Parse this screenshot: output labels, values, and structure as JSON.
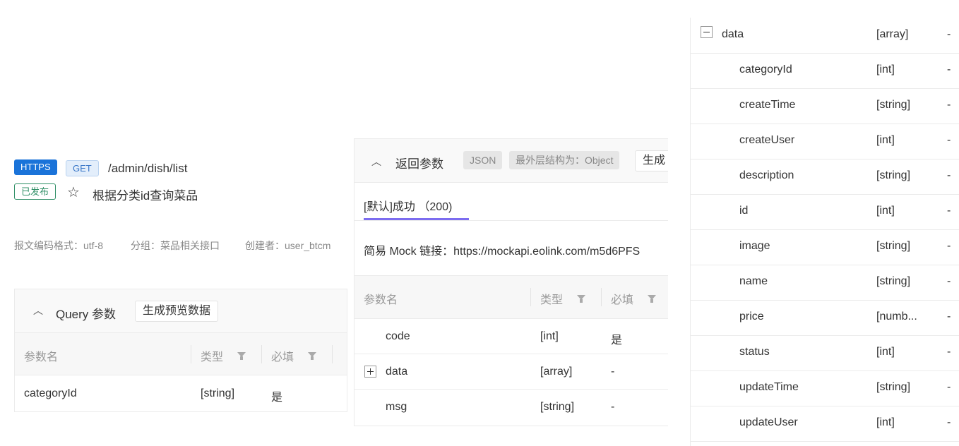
{
  "api": {
    "protocol": "HTTPS",
    "method": "GET",
    "path": "/admin/dish/list",
    "status": "已发布",
    "name": "根据分类id查询菜品",
    "star_icon": "star-icon"
  },
  "meta": {
    "encoding": "报文编码格式：utf-8",
    "group": "分组：菜品相关接口",
    "creator": "创建者：user_btcm"
  },
  "query": {
    "title": "Query 参数",
    "generate_button": "生成预览数据",
    "columns": [
      "参数名",
      "类型",
      "必填"
    ],
    "rows": [
      {
        "name": "categoryId",
        "type": "[string]",
        "required": "是"
      }
    ]
  },
  "response": {
    "title": "返回参数",
    "format_pill": "JSON",
    "outer_pill": "最外层结构为：Object",
    "generate_button": "生成",
    "tab": "[默认]成功 （200)",
    "mock_link": "简易 Mock 链接：https://mockapi.eolink.com/m5d6PFS",
    "columns": [
      "参数名",
      "类型",
      "必填"
    ],
    "rows": [
      {
        "name": "code",
        "type": "[int]",
        "required": "是"
      },
      {
        "name": "data",
        "type": "[array]",
        "required": "-"
      },
      {
        "name": "msg",
        "type": "[string]",
        "required": "-"
      }
    ]
  },
  "data_detail": {
    "rows": [
      {
        "name": "data",
        "type": "[array]",
        "required": "-"
      },
      {
        "name": "categoryId",
        "type": "[int]",
        "required": "-"
      },
      {
        "name": "createTime",
        "type": "[string]",
        "required": "-"
      },
      {
        "name": "createUser",
        "type": "[int]",
        "required": "-"
      },
      {
        "name": "description",
        "type": "[string]",
        "required": "-"
      },
      {
        "name": "id",
        "type": "[int]",
        "required": "-"
      },
      {
        "name": "image",
        "type": "[string]",
        "required": "-"
      },
      {
        "name": "name",
        "type": "[string]",
        "required": "-"
      },
      {
        "name": "price",
        "type": "[numb...",
        "required": "-"
      },
      {
        "name": "status",
        "type": "[int]",
        "required": "-"
      },
      {
        "name": "updateTime",
        "type": "[string]",
        "required": "-"
      },
      {
        "name": "updateUser",
        "type": "[int]",
        "required": "-"
      }
    ]
  },
  "colors": {
    "https_tag": "#1a73d9",
    "published": "#2f8f66",
    "active_tab": "#7c6cf0"
  }
}
